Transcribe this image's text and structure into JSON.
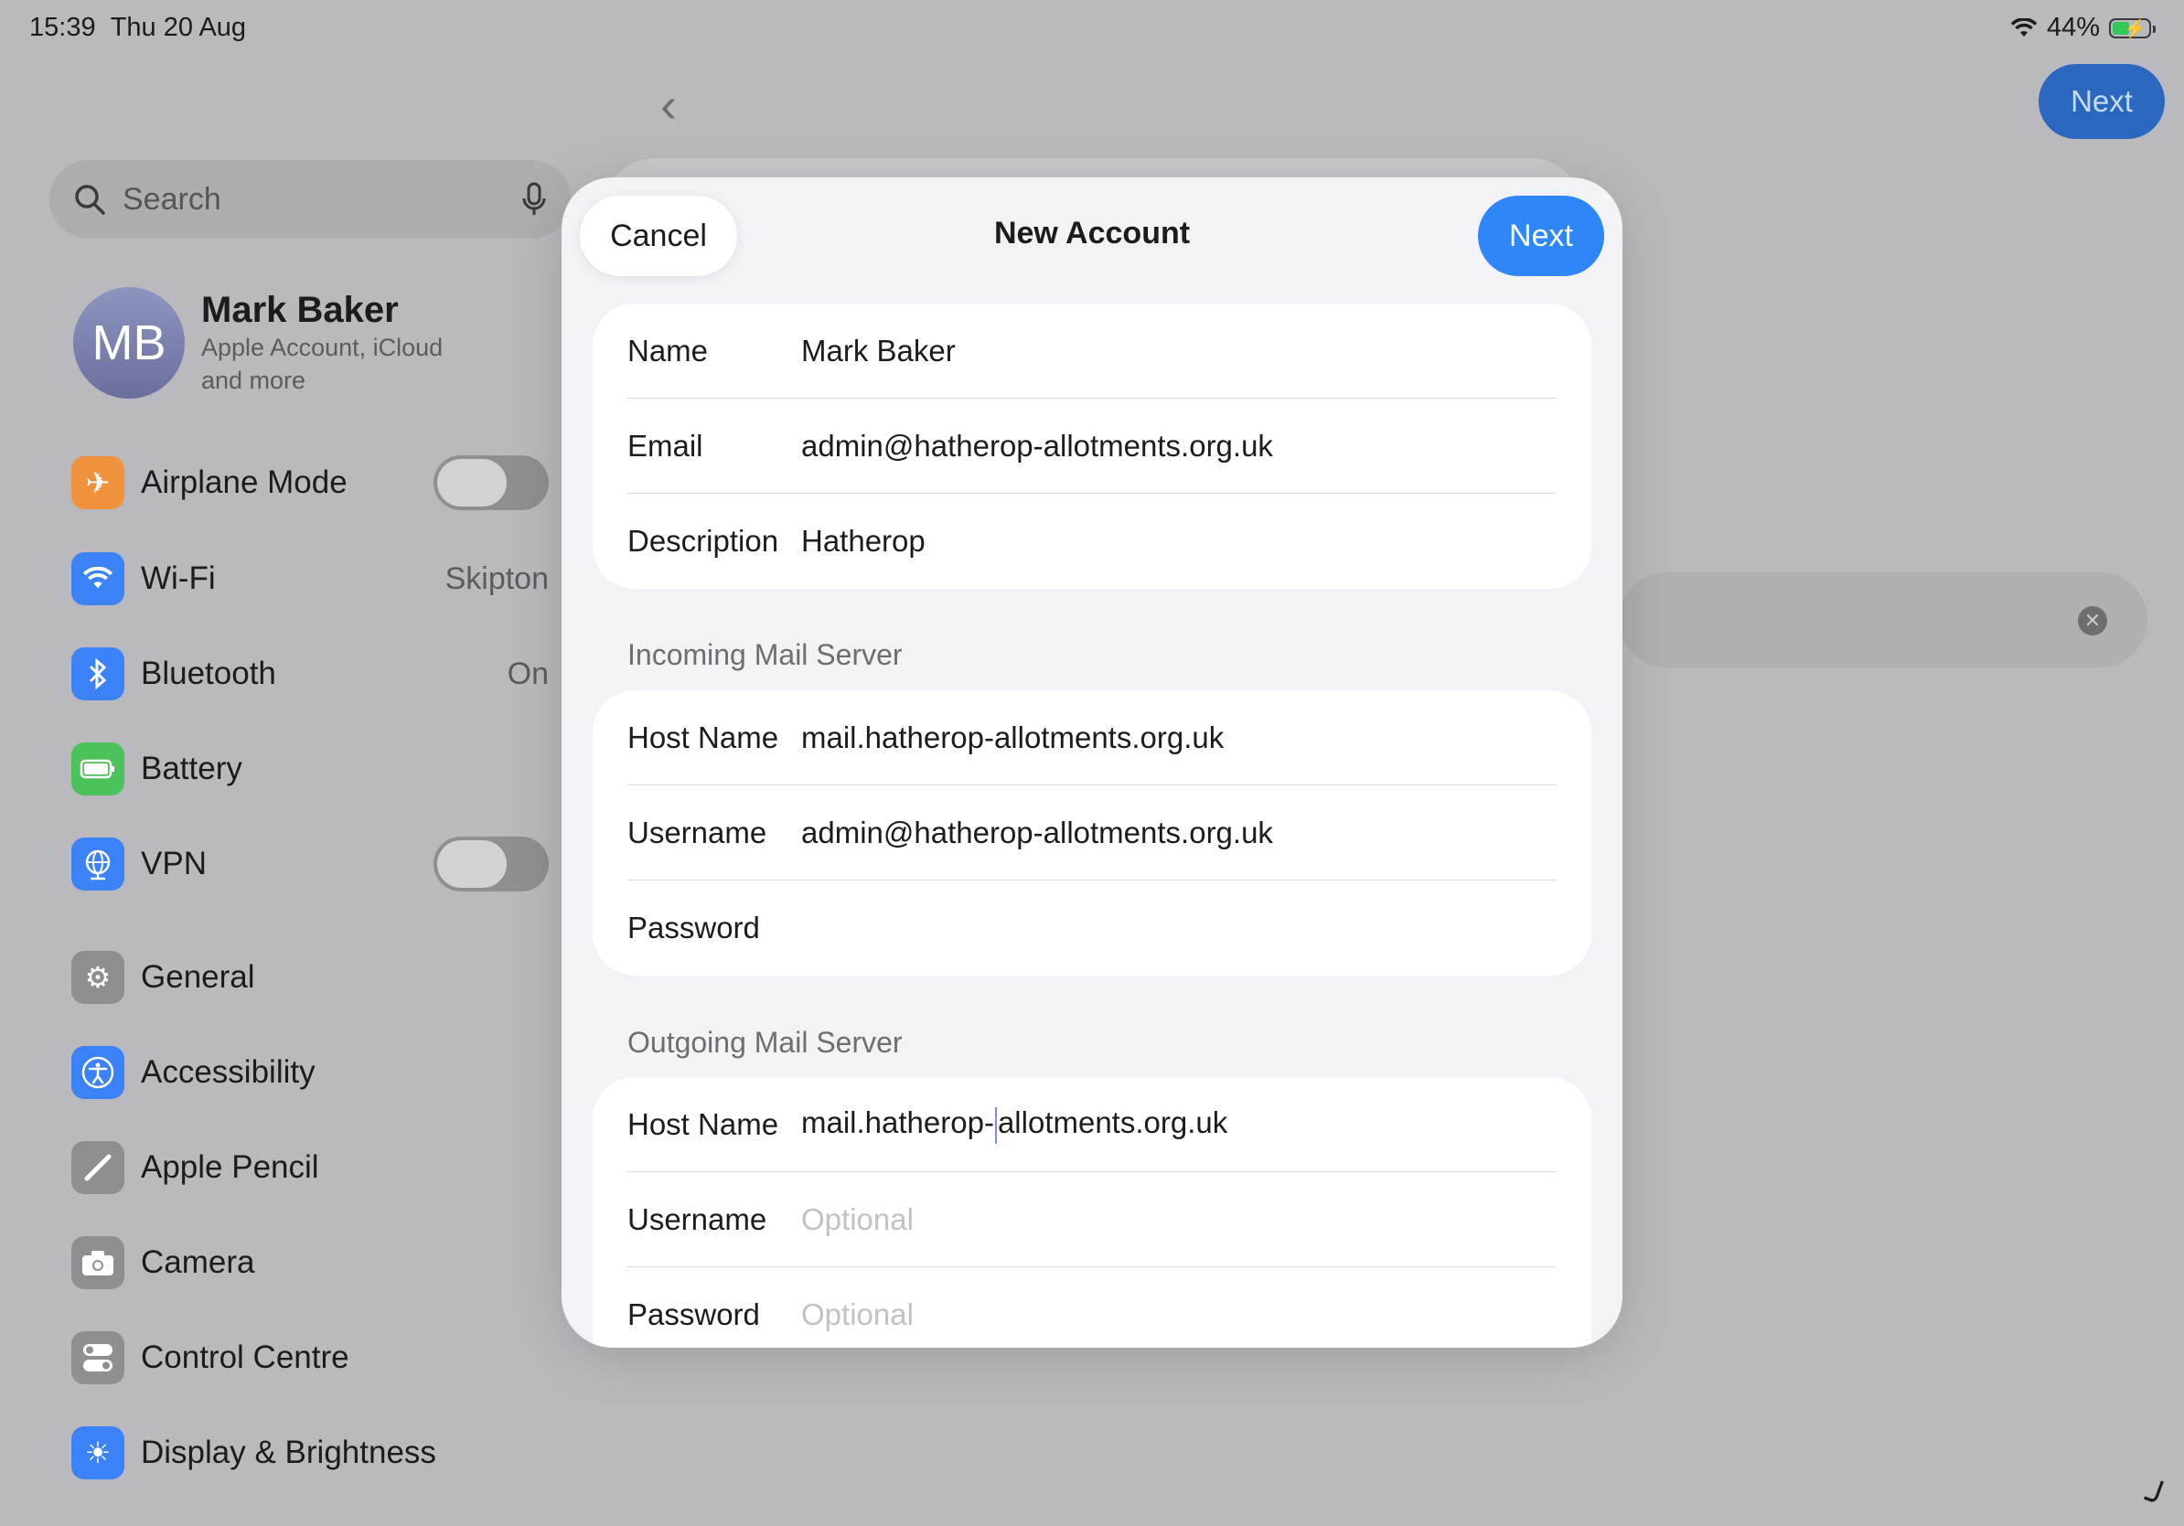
{
  "status_bar": {
    "time": "15:39",
    "date": "Thu 20 Aug",
    "battery": "44%"
  },
  "sidebar": {
    "search_placeholder": "Search",
    "profile": {
      "initials": "MB",
      "name": "Mark Baker",
      "subtitle": "Apple Account, iCloud and more"
    },
    "items": [
      {
        "label": "Airplane Mode",
        "icon": "airplane-icon",
        "color": "#f0913c",
        "toggle": false
      },
      {
        "label": "Wi-Fi",
        "icon": "wifi-icon",
        "color": "#3a82f6",
        "value": "Skipton"
      },
      {
        "label": "Bluetooth",
        "icon": "bluetooth-icon",
        "color": "#3a82f6",
        "value": "On"
      },
      {
        "label": "Battery",
        "icon": "battery-icon",
        "color": "#4cc25a"
      },
      {
        "label": "VPN",
        "icon": "globe-icon",
        "color": "#3a82f6",
        "toggle": false
      },
      {
        "label": "General",
        "icon": "gear-icon",
        "color": "#8e8e93"
      },
      {
        "label": "Accessibility",
        "icon": "accessibility-icon",
        "color": "#3a82f6"
      },
      {
        "label": "Apple Pencil",
        "icon": "pencil-icon",
        "color": "#8e8e93"
      },
      {
        "label": "Camera",
        "icon": "camera-icon",
        "color": "#8e8e93"
      },
      {
        "label": "Control Centre",
        "icon": "switches-icon",
        "color": "#8e8e93"
      },
      {
        "label": "Display & Brightness",
        "icon": "sun-icon",
        "color": "#3a82f6"
      }
    ]
  },
  "background": {
    "next_label": "Next"
  },
  "modal": {
    "cancel_label": "Cancel",
    "title": "New Account",
    "next_label": "Next",
    "account": {
      "name_label": "Name",
      "name_value": "Mark Baker",
      "email_label": "Email",
      "email_value": "admin@hatherop-allotments.org.uk",
      "description_label": "Description",
      "description_value": "Hatherop"
    },
    "incoming": {
      "section_title": "Incoming Mail Server",
      "host_label": "Host Name",
      "host_value": "mail.hatherop-allotments.org.uk",
      "username_label": "Username",
      "username_value": "admin@hatherop-allotments.org.uk",
      "password_label": "Password",
      "password_value": ""
    },
    "outgoing": {
      "section_title": "Outgoing Mail Server",
      "host_label": "Host Name",
      "host_value_before": "mail.hatherop-",
      "host_value_after": "allotments.org.uk",
      "username_label": "Username",
      "username_placeholder": "Optional",
      "password_label": "Password",
      "password_placeholder": "Optional"
    }
  }
}
